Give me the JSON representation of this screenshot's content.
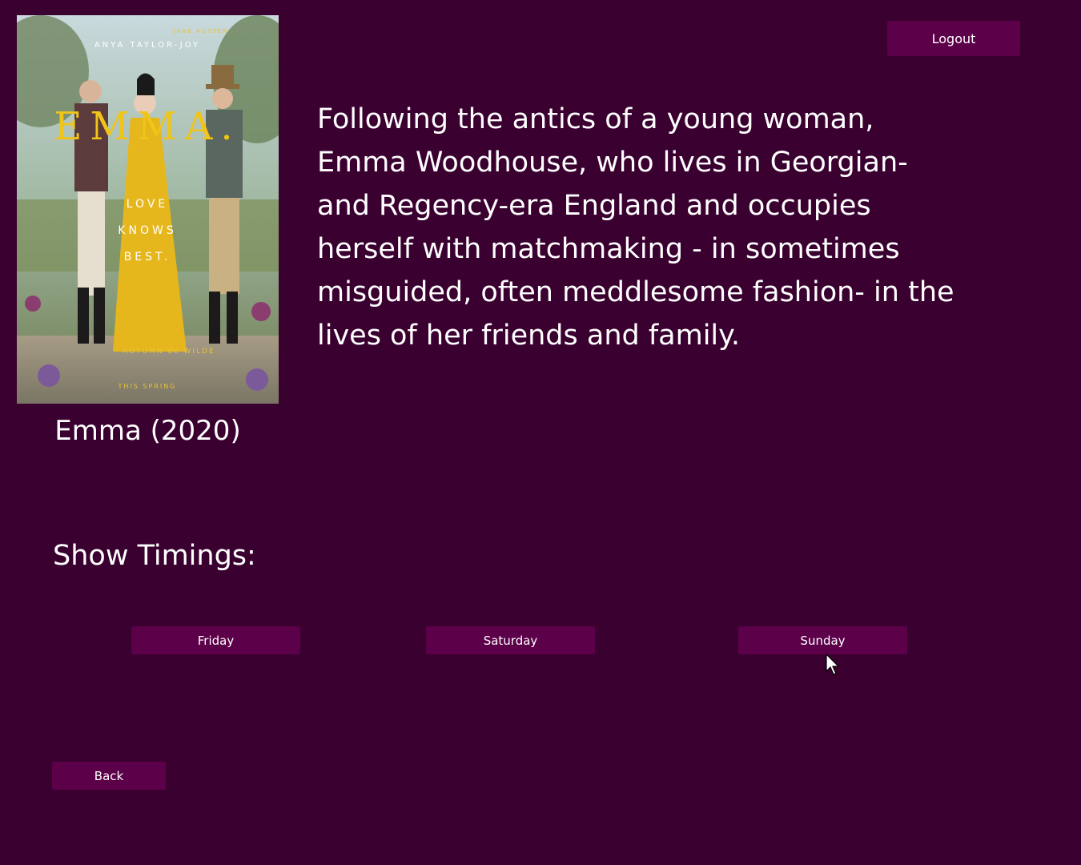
{
  "header": {
    "logout_label": "Logout"
  },
  "movie": {
    "title": "Emma (2020)",
    "description": "Following the antics of a young woman, Emma Woodhouse, who lives in Georgian- and Regency-era England and occupies herself with matchmaking - in sometimes misguided, often meddlesome fashion- in the lives of her friends and family.",
    "poster": {
      "wordmark": "EMMA.",
      "top_credit": "ANYA TAYLOR-JOY",
      "author_credit": "JANE AUSTEN",
      "tagline_lines": [
        "LOVE",
        "KNOWS",
        "BEST."
      ],
      "director_credit": "AUTUMN de WILDE",
      "release": "THIS SPRING"
    }
  },
  "timings": {
    "heading": "Show Timings:",
    "days": [
      {
        "label": "Friday"
      },
      {
        "label": "Saturday"
      },
      {
        "label": "Sunday"
      }
    ]
  },
  "footer": {
    "back_label": "Back"
  },
  "colors": {
    "background": "#3a0030",
    "button": "#5c0049",
    "text": "#ffffff"
  }
}
